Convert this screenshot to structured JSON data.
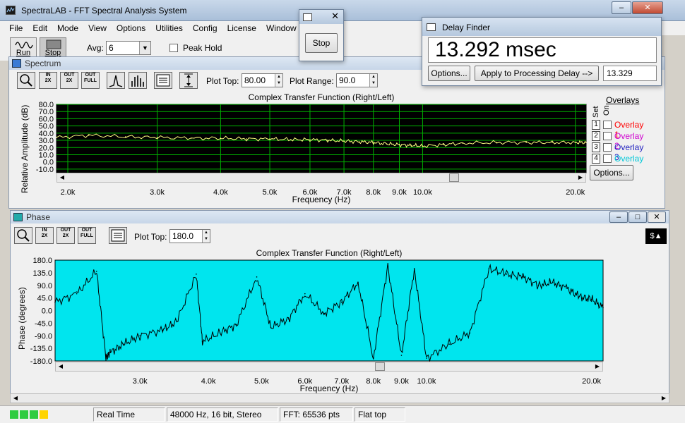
{
  "window": {
    "title": "SpectraLAB - FFT Spectral Analysis System",
    "min": "–",
    "max": "□",
    "close": "✕"
  },
  "menu": [
    "File",
    "Edit",
    "Mode",
    "View",
    "Options",
    "Utilities",
    "Config",
    "License",
    "Window"
  ],
  "toolbar": {
    "run": "Run",
    "stop": "Stop",
    "avg_label": "Avg:",
    "avg_value": "6",
    "peak_hold": "Peak Hold"
  },
  "stop_window": {
    "button": "Stop"
  },
  "delay_finder": {
    "title": "Delay Finder",
    "readout": "13.292 msec",
    "options": "Options...",
    "apply": "Apply to Processing Delay -->",
    "value": "13.329"
  },
  "spectrum": {
    "title": "Spectrum",
    "plot_top_label": "Plot Top:",
    "plot_top": "80.00",
    "plot_range_label": "Plot Range:",
    "plot_range": "90.0",
    "plot_title": "Complex Transfer Function (Right/Left)",
    "ylabel": "Relative Amplitude (dB)",
    "xlabel": "Frequency (Hz)",
    "yticks": [
      "80.0",
      "70.0",
      "60.0",
      "50.0",
      "40.0",
      "30.0",
      "20.0",
      "10.0",
      "0.0",
      "-10.0"
    ],
    "xticks": [
      "2.0k",
      "3.0k",
      "4.0k",
      "5.0k",
      "6.0k",
      "7.0k",
      "8.0k",
      "9.0k",
      "10.0k",
      "20.0k"
    ],
    "overlays_title": "Overlays",
    "col_set": "Set",
    "col_on": "On",
    "overlays": [
      {
        "num": "1",
        "name": "Overlay 1",
        "color": "#ff0000"
      },
      {
        "num": "2",
        "name": "Overlay 2",
        "color": "#d000d0"
      },
      {
        "num": "3",
        "name": "Overlay 3",
        "color": "#2020c0"
      },
      {
        "num": "4",
        "name": "Overlay 4",
        "color": "#00c8d8"
      }
    ],
    "options_button": "Options..."
  },
  "phase": {
    "title": "Phase",
    "plot_top_label": "Plot Top:",
    "plot_top": "180.0",
    "plot_title": "Complex Transfer Function (Right/Left)",
    "ylabel": "Phase (degrees)",
    "xlabel": "Frequency (Hz)",
    "yticks": [
      "180.0",
      "135.0",
      "90.0",
      "45.0",
      "0.0",
      "-45.0",
      "-90.0",
      "-135.0",
      "-180.0"
    ],
    "xticks": [
      "3.0k",
      "4.0k",
      "5.0k",
      "6.0k",
      "7.0k",
      "8.0k",
      "9.0k",
      "10.0k",
      "20.0k"
    ]
  },
  "zoom_buttons": {
    "in": "IN",
    "out": "OUT",
    "full": "FULL",
    "x2": "2X"
  },
  "status": {
    "mode": "Real Time",
    "format": "48000 Hz, 16 bit, Stereo",
    "fft": "FFT: 65536 pts",
    "window": "Flat top"
  },
  "colors": {
    "spectrum_bg": "#000000",
    "spectrum_grid": "#00b000",
    "spectrum_trace": "#ffff80",
    "phase_bg": "#00e5ee",
    "phase_trace": "#000000"
  },
  "chart_data": [
    {
      "type": "line",
      "title": "Complex Transfer Function (Right/Left)",
      "xlabel": "Frequency (Hz)",
      "ylabel": "Relative Amplitude (dB)",
      "xscale": "log",
      "xlim": [
        1900,
        21000
      ],
      "ylim": [
        -15,
        80
      ],
      "grid": true,
      "series": [
        {
          "x": [
            1900,
            2200,
            2600,
            3000,
            3500,
            4000,
            4500,
            5000,
            5500,
            6000,
            6500,
            7000,
            7500,
            8000,
            8500,
            9000,
            9500,
            10000,
            11000,
            12000,
            14000,
            16000,
            18000,
            20000,
            21000
          ],
          "values": [
            34,
            37,
            35,
            34,
            33,
            33,
            32,
            32,
            31,
            31,
            30,
            29,
            28,
            27,
            25,
            24,
            23,
            22,
            24,
            26,
            27,
            27,
            27,
            27,
            27
          ]
        }
      ]
    },
    {
      "type": "line",
      "title": "Complex Transfer Function (Right/Left)",
      "xlabel": "Frequency (Hz)",
      "ylabel": "Phase (degrees)",
      "xscale": "log",
      "xlim": [
        2100,
        21000
      ],
      "ylim": [
        -180,
        180
      ],
      "grid": false,
      "series": [
        {
          "x": [
            2100,
            2300,
            2500,
            2600,
            2650,
            2800,
            3000,
            3300,
            3500,
            3800,
            3900,
            4200,
            4500,
            4900,
            5200,
            5600,
            6000,
            6500,
            7000,
            7500,
            8000,
            8500,
            9000,
            9500,
            10000,
            11000,
            12000,
            13000,
            14000,
            15000,
            16000,
            17000,
            18000,
            19000,
            20000,
            21000
          ],
          "values": [
            30,
            60,
            140,
            -170,
            -150,
            -120,
            -90,
            -70,
            -40,
            130,
            -110,
            -80,
            -50,
            120,
            -60,
            -30,
            60,
            -10,
            30,
            100,
            -170,
            160,
            -160,
            150,
            -170,
            -120,
            -80,
            150,
            130,
            120,
            90,
            100,
            80,
            50,
            40,
            10
          ]
        }
      ]
    }
  ]
}
